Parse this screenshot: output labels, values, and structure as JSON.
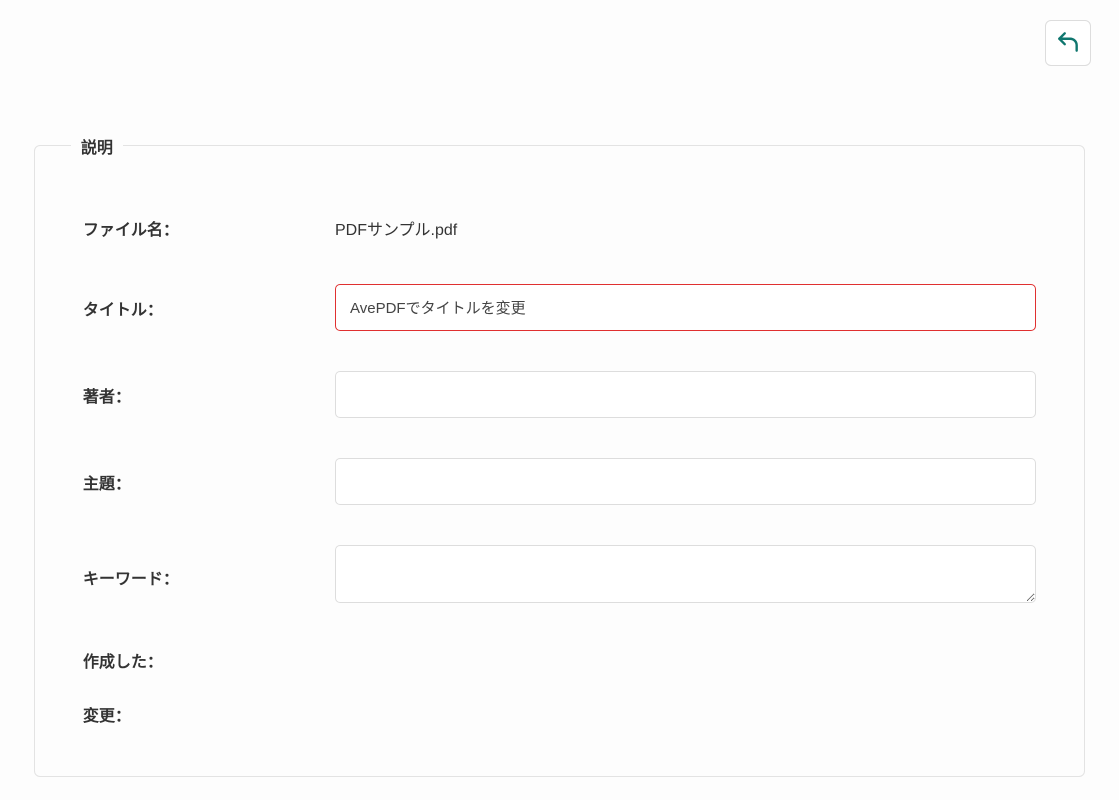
{
  "header": {
    "back_icon": "back-arrow-icon"
  },
  "fieldset": {
    "legend": "説明",
    "fields": {
      "filename": {
        "label": "ファイル名：",
        "value": "PDFサンプル.pdf"
      },
      "title": {
        "label": "タイトル：",
        "value": "AvePDFでタイトルを変更"
      },
      "author": {
        "label": "著者：",
        "value": ""
      },
      "subject": {
        "label": "主題：",
        "value": ""
      },
      "keywords": {
        "label": "キーワード：",
        "value": ""
      },
      "created": {
        "label": "作成した：",
        "value": ""
      },
      "modified": {
        "label": "変更：",
        "value": ""
      }
    }
  }
}
